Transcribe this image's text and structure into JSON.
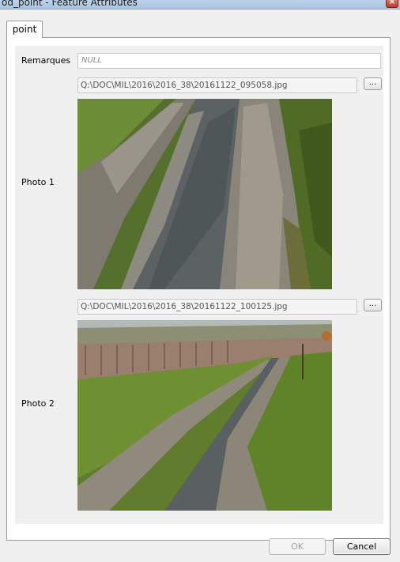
{
  "window": {
    "title": "od_point - Feature Attributes",
    "close_icon": "close-icon"
  },
  "tabs": [
    {
      "label": "point",
      "selected": true
    }
  ],
  "form": {
    "remarques": {
      "label": "Remarques",
      "value": "NULL"
    },
    "photo1": {
      "label": "Photo 1",
      "path": "Q:\\DOC\\MIL\\2016\\2016_38\\20161122_095058.jpg",
      "browse_label": "..."
    },
    "photo2": {
      "label": "Photo 2",
      "path": "Q:\\DOC\\MIL\\2016\\2016_38\\20161122_100125.jpg",
      "browse_label": "..."
    }
  },
  "buttons": {
    "ok_label": "OK",
    "ok_enabled": false,
    "cancel_label": "Cancel"
  }
}
